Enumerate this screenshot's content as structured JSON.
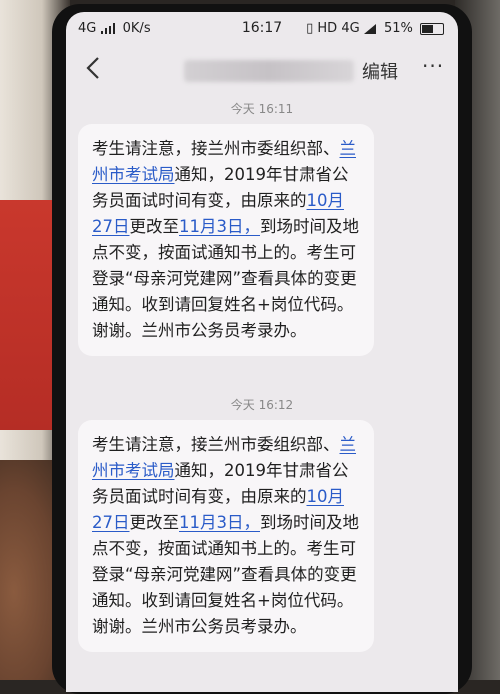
{
  "status_bar": {
    "network": "4G",
    "speed": "0K/s",
    "time": "16:17",
    "right_indicators": "HD 4G",
    "battery": "51%"
  },
  "nav": {
    "edit_label": "编辑",
    "more_label": "···"
  },
  "messages": [
    {
      "timestamp": "今天 16:11",
      "parts": [
        {
          "text": "考生请注意，接兰州市委组织部、",
          "link": false
        },
        {
          "text": "兰州市考试局",
          "link": true
        },
        {
          "text": "通知，2019年甘肃省公务员面试时间有变，由原来的",
          "link": false
        },
        {
          "text": "10月27日",
          "link": true
        },
        {
          "text": "更改至",
          "link": false
        },
        {
          "text": "11月3日，",
          "link": true
        },
        {
          "text": "到场时间及地点不变，按面试通知书上的。考生可登录“母亲河党建网”查看具体的变更通知。收到请回复姓名+岗位代码。谢谢。兰州市公务员考录办。",
          "link": false
        }
      ]
    },
    {
      "timestamp": "今天 16:12",
      "parts": [
        {
          "text": "考生请注意，接兰州市委组织部、",
          "link": false
        },
        {
          "text": "兰州市考试局",
          "link": true
        },
        {
          "text": "通知，2019年甘肃省公务员面试时间有变，由原来的",
          "link": false
        },
        {
          "text": "10月27日",
          "link": true
        },
        {
          "text": "更改至",
          "link": false
        },
        {
          "text": "11月3日，",
          "link": true
        },
        {
          "text": "到场时间及地点不变，按面试通知书上的。考生可登录“母亲河党建网”查看具体的变更通知。收到请回复姓名+岗位代码。谢谢。兰州市公务员考录办。",
          "link": false
        }
      ]
    }
  ]
}
